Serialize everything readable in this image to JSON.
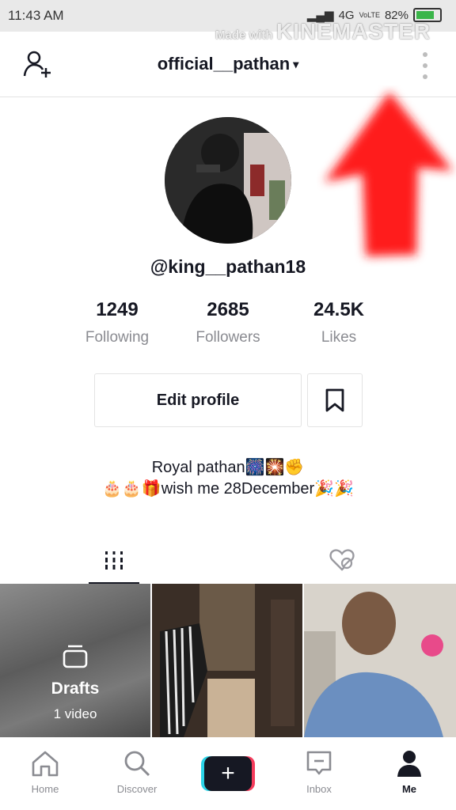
{
  "status_bar": {
    "time": "11:43 AM",
    "network": "4G",
    "volte": "VoLTE",
    "battery": "82%"
  },
  "watermark": {
    "prefix": "Made with",
    "brand": "KINEMASTER"
  },
  "header": {
    "username": "official__pathan",
    "caret": "▾"
  },
  "profile": {
    "handle": "@king__pathan18",
    "stats": [
      {
        "value": "1249",
        "label": "Following"
      },
      {
        "value": "2685",
        "label": "Followers"
      },
      {
        "value": "24.5K",
        "label": "Likes"
      }
    ],
    "edit_label": "Edit profile",
    "bio_line1": "Royal pathan🎆🎇✊",
    "bio_line2": "🎂🎂🎁wish me 28December🎉🎉"
  },
  "grid": {
    "drafts_title": "Drafts",
    "drafts_count": "1 video"
  },
  "tabbar": {
    "home": "Home",
    "discover": "Discover",
    "create": "+",
    "inbox": "Inbox",
    "me": "Me"
  },
  "colors": {
    "accent_cyan": "#2bd4e8",
    "accent_red": "#f53c5c",
    "text_primary": "#161823",
    "text_secondary": "#8a8b91",
    "annotation_arrow": "#ff1a1a"
  }
}
